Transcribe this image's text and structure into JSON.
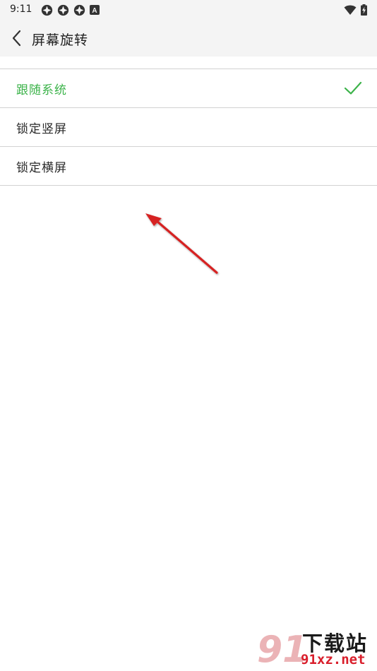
{
  "status_bar": {
    "time": "9:11",
    "left_icons": [
      "app-notification-icon",
      "app-notification-icon",
      "app-notification-icon",
      "a-badge-icon"
    ],
    "a_badge_text": "A",
    "right_icons": [
      "wifi-icon",
      "battery-charging-icon"
    ]
  },
  "app_bar": {
    "back_icon": "chevron-left-icon",
    "title": "屏幕旋转"
  },
  "options": [
    {
      "label": "跟随系统",
      "selected": true
    },
    {
      "label": "锁定竖屏",
      "selected": false
    },
    {
      "label": "锁定横屏",
      "selected": false
    }
  ],
  "colors": {
    "accent": "#3cb34a",
    "app_bar_bg": "#f4f4f4",
    "divider": "#d2d2d2",
    "annotation_arrow": "#d62222"
  },
  "watermark": {
    "mark": "91",
    "title": "下载站",
    "url": "91xz.net"
  }
}
